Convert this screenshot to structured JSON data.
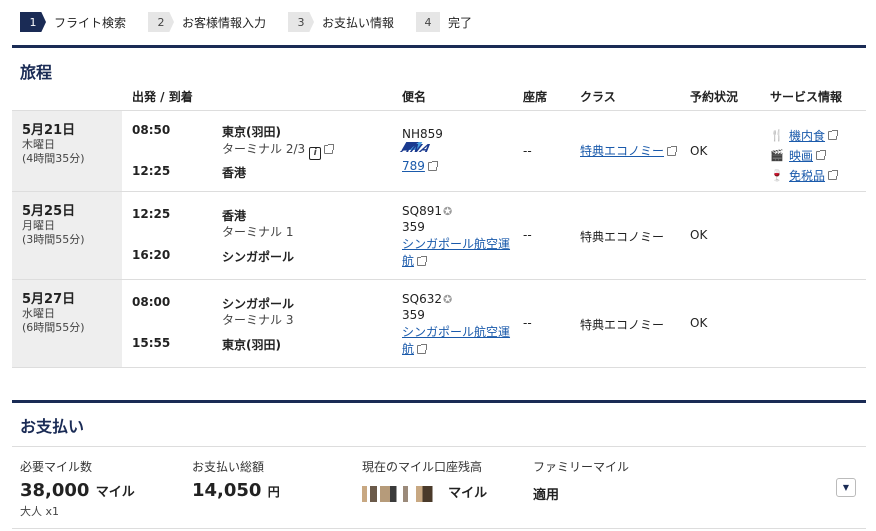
{
  "steps": [
    {
      "num": "1",
      "label": "フライト検索"
    },
    {
      "num": "2",
      "label": "お客様情報入力"
    },
    {
      "num": "3",
      "label": "お支払い情報"
    },
    {
      "num": "4",
      "label": "完了"
    }
  ],
  "itinerary": {
    "title": "旅程",
    "headers": {
      "dep_arr": "出発 / 到着",
      "flight": "便名",
      "seat": "座席",
      "class": "クラス",
      "status": "予約状況",
      "service": "サービス情報"
    },
    "rows": [
      {
        "date": "5月21日",
        "weekday": "木曜日",
        "duration": "(4時間35分)",
        "dep_time": "08:50",
        "dep_city": "東京(羽田)",
        "dep_terminal": "ターミナル 2/3",
        "arr_time": "12:25",
        "arr_city": "香港",
        "arr_terminal": "",
        "flight_no": "NH859",
        "airline": "ANA",
        "aircraft": "789",
        "operator": "",
        "seat": "--",
        "class": "特典エコノミー",
        "status": "OK",
        "services": [
          {
            "icon": "meal-icon",
            "label": "機内食"
          },
          {
            "icon": "movie-icon",
            "label": "映画"
          },
          {
            "icon": "dutyfree-icon",
            "label": "免税品"
          }
        ]
      },
      {
        "date": "5月25日",
        "weekday": "月曜日",
        "duration": "(3時間55分)",
        "dep_time": "12:25",
        "dep_city": "香港",
        "dep_terminal": "ターミナル 1",
        "arr_time": "16:20",
        "arr_city": "シンガポール",
        "arr_terminal": "",
        "flight_no": "SQ891",
        "aircraft": "359",
        "operator": "シンガポール航空運航",
        "seat": "--",
        "class": "特典エコノミー",
        "status": "OK",
        "services": []
      },
      {
        "date": "5月27日",
        "weekday": "水曜日",
        "duration": "(6時間55分)",
        "dep_time": "08:00",
        "dep_city": "シンガポール",
        "dep_terminal": "ターミナル 3",
        "arr_time": "15:55",
        "arr_city": "東京(羽田)",
        "arr_terminal": "",
        "flight_no": "SQ632",
        "aircraft": "359",
        "operator": "シンガポール航空運航",
        "seat": "--",
        "class": "特典エコノミー",
        "status": "OK",
        "services": []
      }
    ]
  },
  "payment": {
    "title": "お支払い",
    "required_miles_label": "必要マイル数",
    "required_miles": "38,000",
    "miles_unit": "マイル",
    "pax": "大人 x1",
    "total_label": "お支払い総額",
    "total": "14,050",
    "yen": "円",
    "balance_label": "現在のマイル口座残高",
    "balance_unit": "マイル",
    "family_label": "ファミリーマイル",
    "family_value": "適用"
  },
  "colors": {
    "navy": "#1a2b55",
    "link": "#1a5aab",
    "date_bg": "#eeeeee"
  }
}
